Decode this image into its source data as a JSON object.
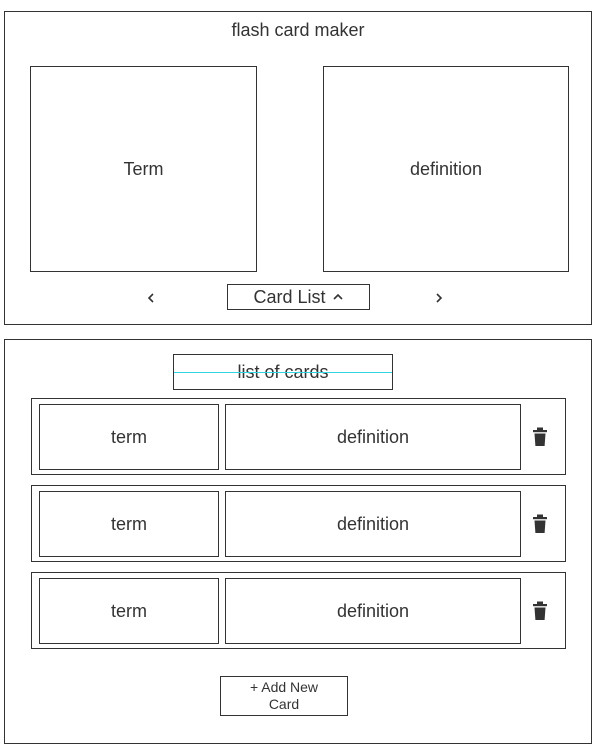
{
  "header": {
    "title": "flash card maker"
  },
  "flashcard": {
    "term_label": "Term",
    "definition_label": "definition",
    "prev_icon": "chevron-left-icon",
    "next_icon": "chevron-right-icon",
    "card_list_label": "Card List",
    "card_list_icon": "chevron-up-icon"
  },
  "card_list": {
    "title": "list of cards",
    "rows": [
      {
        "term": "term",
        "definition": "definition",
        "delete_icon": "trash-icon"
      },
      {
        "term": "term",
        "definition": "definition",
        "delete_icon": "trash-icon"
      },
      {
        "term": "term",
        "definition": "definition",
        "delete_icon": "trash-icon"
      }
    ],
    "add_button_label": "+ Add New\nCard"
  },
  "colors": {
    "border": "#333333",
    "accent_line": "#2fd6e0",
    "text": "#333333"
  }
}
